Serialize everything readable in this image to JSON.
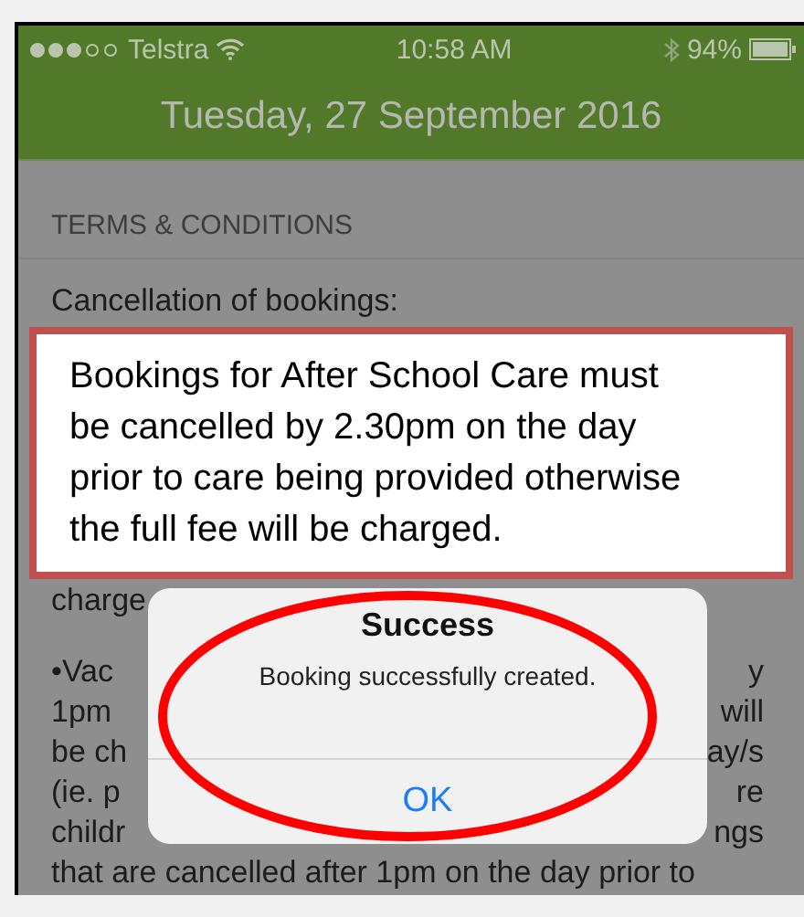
{
  "status_bar": {
    "carrier": "Telstra",
    "time": "10:58 AM",
    "battery": "94%"
  },
  "header": {
    "title": "Tuesday, 27 September 2016"
  },
  "section": {
    "heading": "TERMS & CONDITIONS"
  },
  "content": {
    "heading": "Cancellation of bookings:",
    "cut_line": "charge",
    "lines": [
      {
        "left": "•Vac",
        "right": "y"
      },
      {
        "left": "1pm",
        "right": "will"
      },
      {
        "left": "be ch",
        "right": "ay/s"
      },
      {
        "left": "(ie. p",
        "right": "re"
      },
      {
        "left": "childr",
        "right": "ngs"
      },
      {
        "left": "that are cancelled after 1pm on the day prior to"
      }
    ]
  },
  "callout": {
    "text": "Bookings for After School Care must be cancelled by 2.30pm on the day prior to care being provided otherwise the full fee will be charged."
  },
  "alert": {
    "title": "Success",
    "message": "Booking successfully created.",
    "buttons": [
      "OK"
    ]
  }
}
